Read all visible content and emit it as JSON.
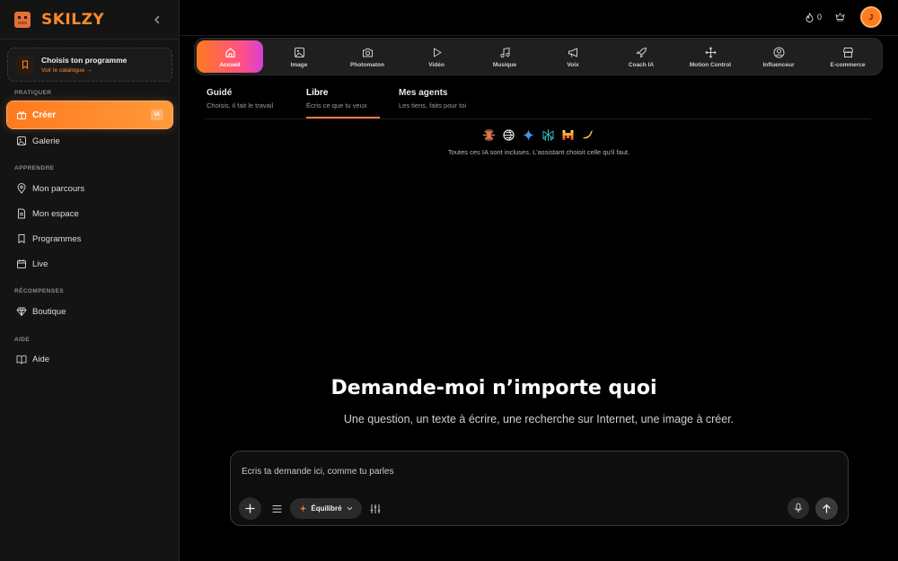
{
  "brand": {
    "name": "SKILZY"
  },
  "program_card": {
    "title": "Choisis ton programme",
    "link": "Voir le catalogue →"
  },
  "sidebar": {
    "sections": {
      "pratiquer": "PRATIQUER",
      "apprendre": "APPRENDRE",
      "recompenses": "RÉCOMPENSES",
      "aide": "AIDE"
    },
    "items": {
      "creer": {
        "label": "Créer",
        "badge": "IA"
      },
      "galerie": {
        "label": "Galerie"
      },
      "mon_parcours": {
        "label": "Mon parcours"
      },
      "mon_espace": {
        "label": "Mon espace"
      },
      "programmes": {
        "label": "Programmes"
      },
      "live": {
        "label": "Live"
      },
      "boutique": {
        "label": "Boutique"
      },
      "aide": {
        "label": "Aide"
      }
    }
  },
  "header": {
    "streak_count": "0",
    "avatar_initial": "J"
  },
  "tools": {
    "accueil": "Accueil",
    "image": "Image",
    "photomaton": "Photomaton",
    "video": "Vidéo",
    "musique": "Musique",
    "voix": "Voix",
    "coach": "Coach IA",
    "motion": "Motion Control",
    "influenceur": "Influenceur",
    "ecommerce": "E-commerce"
  },
  "modes": {
    "guide": {
      "title": "Guidé",
      "subtitle": "Choisis, il fait le travail"
    },
    "libre": {
      "title": "Libre",
      "subtitle": "Écris ce que tu veux"
    },
    "agents": {
      "title": "Mes agents",
      "subtitle": "Les tiens, faits pour toi"
    }
  },
  "models_note": "Toutes ces IA sont incluses. L'assistant choisit celle qu'il faut.",
  "hero": {
    "title": "Demande-moi n’importe quoi",
    "subtitle": "Une question, un texte à écrire, une recherche sur Internet, une image à créer."
  },
  "composer": {
    "placeholder": "Écris ta demande ici, comme tu parles",
    "mode_label": "Équilibré"
  },
  "colors": {
    "accent": "#ff7a1f",
    "background": "#000000",
    "sidebar": "#141414"
  }
}
